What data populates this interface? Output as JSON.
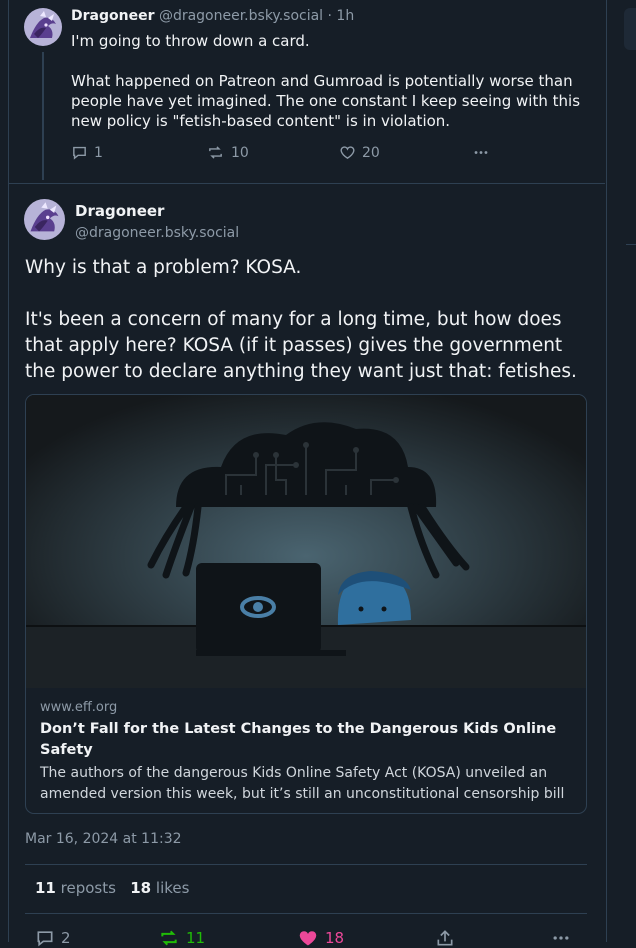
{
  "parent_post": {
    "author_name": "Dragoneer",
    "author_handle": "@dragoneer.bsky.social",
    "time_ago": "· 1h",
    "paragraphs": [
      "I'm going to throw down a card.",
      "What happened on Patreon and Gumroad is potentially worse than people have yet imagined. The one constant I keep seeing with this new policy is \"fetish-based content\" is in violation."
    ],
    "reply_count": "1",
    "repost_count": "10",
    "like_count": "20",
    "icons": {
      "reply": "reply-icon",
      "repost": "repost-icon",
      "like": "heart-icon",
      "more": "more-icon"
    }
  },
  "main_post": {
    "author_name": "Dragoneer",
    "author_handle": "@dragoneer.bsky.social",
    "paragraphs": [
      "Why is that a problem? KOSA.",
      "It's been a concern of many for a long time, but how does that apply here? KOSA (if it passes) gives the government the power to declare anything they want just that: fetishes."
    ],
    "link_card": {
      "domain": "www.eff.org",
      "title": "Don’t Fall for the Latest Changes to the Dangerous Kids Online Safety",
      "description": "The authors of the dangerous Kids Online Safety Act (KOSA) unveiled an amended version this week, but it’s still an unconstitutional censorship bill ..."
    },
    "timestamp": "Mar 16, 2024 at 11:32",
    "stats": {
      "reposts_count": "11",
      "reposts_label": "reposts",
      "likes_count": "18",
      "likes_label": "likes"
    },
    "bottom_actions": {
      "reply_count": "2",
      "repost_count": "11",
      "like_count": "18"
    }
  },
  "colors": {
    "background": "#161e27",
    "border": "#2e4052",
    "muted_text": "#8d9aa7",
    "repost_active": "#20bc07",
    "like_active": "#ec4899"
  }
}
